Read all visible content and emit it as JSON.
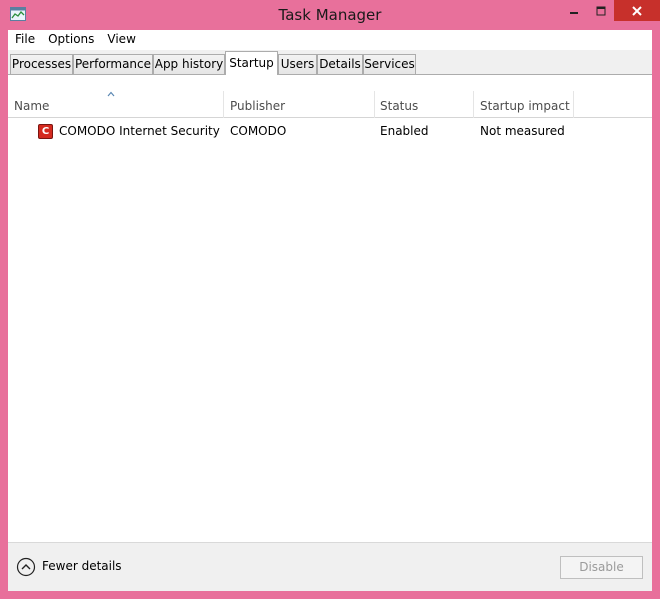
{
  "window": {
    "title": "Task Manager",
    "frame_color": "#e8709b",
    "close_color": "#c7302b"
  },
  "icons": {
    "app": "task-manager-icon",
    "minimize": "minimize-icon",
    "maximize": "maximize-icon",
    "close": "close-icon",
    "sort": "sort-ascending-icon",
    "row": "comodo-icon",
    "fewer": "chevron-up-circle-icon"
  },
  "menu": {
    "items": [
      {
        "label": "File"
      },
      {
        "label": "Options"
      },
      {
        "label": "View"
      }
    ]
  },
  "tabs": [
    {
      "label": "Processes"
    },
    {
      "label": "Performance"
    },
    {
      "label": "App history"
    },
    {
      "label": "Startup",
      "active": true
    },
    {
      "label": "Users"
    },
    {
      "label": "Details"
    },
    {
      "label": "Services"
    }
  ],
  "table": {
    "columns": [
      {
        "label": "Name"
      },
      {
        "label": "Publisher"
      },
      {
        "label": "Status"
      },
      {
        "label": "Startup impact"
      }
    ],
    "rows": [
      {
        "icon_letter": "C",
        "name": "COMODO Internet Security",
        "publisher": "COMODO",
        "status": "Enabled",
        "impact": "Not measured"
      }
    ]
  },
  "footer": {
    "fewer_details_label": "Fewer details",
    "disable_label": "Disable"
  }
}
